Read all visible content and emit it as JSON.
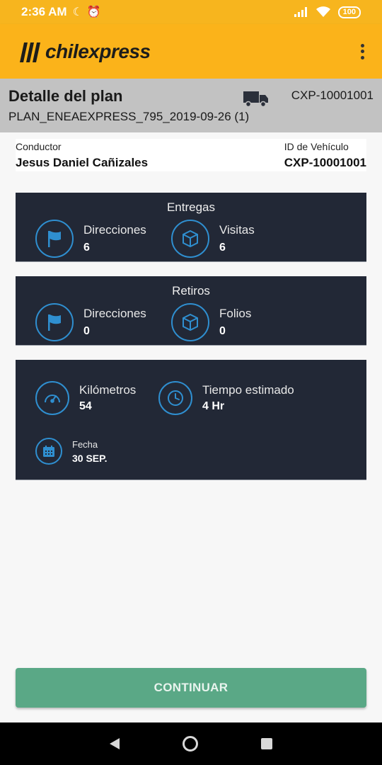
{
  "status_bar": {
    "time": "2:36 AM",
    "battery": "100",
    "icons": [
      "moon-icon",
      "alarm-icon",
      "signal-icon",
      "wifi-icon",
      "battery-icon"
    ]
  },
  "app_bar": {
    "logo_text": "chilexpress",
    "brand_color": "#fbb31a",
    "menu_icon": "more-vert-icon"
  },
  "plan": {
    "title": "Detalle del plan",
    "code": "PLAN_ENEAEXPRESS_795_2019-09-26 (1)",
    "vehicle_id": "CXP-10001001",
    "truck_icon": "truck-icon"
  },
  "driver": {
    "conductor_label": "Conductor",
    "conductor_value": "Jesus Daniel Cañizales",
    "vehicle_label": "ID de Vehículo",
    "vehicle_value": "CXP-10001001"
  },
  "entregas": {
    "title": "Entregas",
    "direcciones_label": "Direcciones",
    "direcciones_value": "6",
    "visitas_label": "Visitas",
    "visitas_value": "6"
  },
  "retiros": {
    "title": "Retiros",
    "direcciones_label": "Direcciones",
    "direcciones_value": "0",
    "folios_label": "Folios",
    "folios_value": "0"
  },
  "resumen": {
    "km_label": "Kilómetros",
    "km_value": "54",
    "tiempo_label": "Tiempo estimado",
    "tiempo_value": "4 Hr",
    "fecha_label": "Fecha",
    "fecha_value": "30 SEP."
  },
  "actions": {
    "continue_label": "CONTINUAR",
    "continue_color": "#5aa886"
  },
  "colors": {
    "card_bg": "#222836",
    "icon_accent": "#2f8fd0",
    "header_gray": "#c2c2c2"
  }
}
